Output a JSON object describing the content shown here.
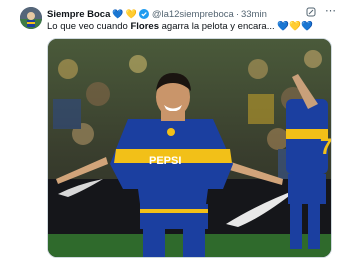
{
  "tweet": {
    "author_name": "Siempre Boca",
    "heart_emoji_1": "💙",
    "heart_emoji_2": "💛",
    "handle": "@la12siempreboca",
    "separator": "·",
    "time": "33min",
    "text_before": "Lo que veo cuando ",
    "text_bold": "Flores",
    "text_after": " agarra la pelota y encara...",
    "text_emojis": [
      "💙",
      "💛",
      "💙"
    ],
    "media": {
      "jersey_text": "PEPSI",
      "teammate_number": "7",
      "alt": "Boca player celebrating in stadium"
    }
  },
  "icons": {
    "verified": "verified-badge-icon",
    "grok": "grok-icon",
    "more": "more-icon"
  },
  "colors": {
    "boca_blue": "#1b3fa0",
    "boca_yellow": "#f2c018",
    "verified_blue": "#1d9bf0",
    "muted_text": "#536471"
  }
}
